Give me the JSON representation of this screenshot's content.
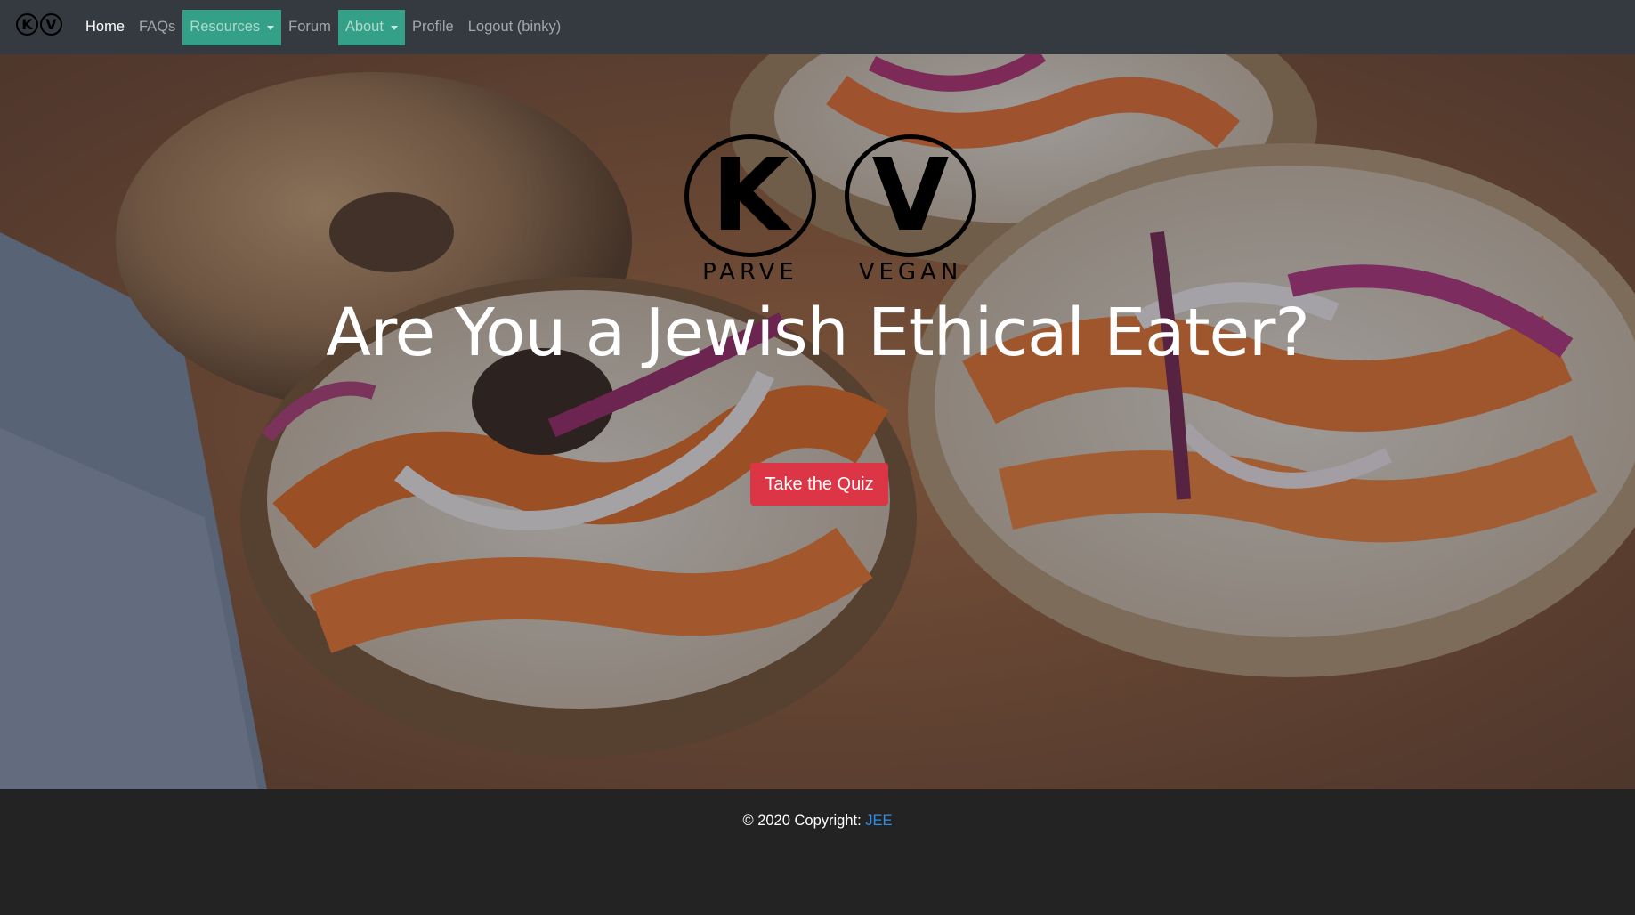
{
  "navbar": {
    "brand": {
      "letters": [
        "K",
        "V"
      ],
      "captions": [
        "PARVE",
        "VEGAN"
      ]
    },
    "links": {
      "home": "Home",
      "faqs": "FAQs",
      "resources": "Resources",
      "forum": "Forum",
      "about": "About",
      "profile": "Profile",
      "logout": "Logout (binky)"
    },
    "dropdown_color": "#33a087",
    "background": "#343a40"
  },
  "hero": {
    "logo": {
      "k_letter": "K",
      "v_letter": "V",
      "k_caption": "PARVE",
      "v_caption": "VEGAN"
    },
    "headline": "Are You a Jewish Ethical Eater?",
    "cta_label": "Take the Quiz",
    "cta_color": "#dc3545",
    "background_image": "bagels-with-carrot-lox-cream-cheese-onion-dill"
  },
  "footer": {
    "copyright_prefix": "© 2020 Copyright: ",
    "link_text": "JEE",
    "link_color": "#2f8fe8"
  },
  "icons": {
    "caret": "chevron-down-icon"
  }
}
